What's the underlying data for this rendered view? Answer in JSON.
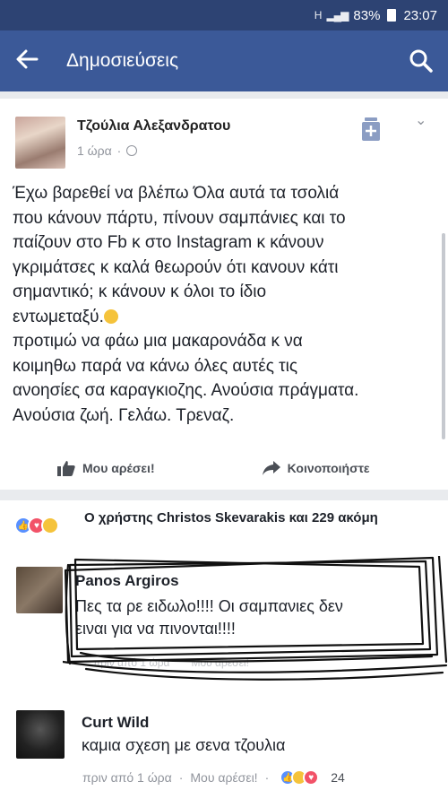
{
  "status_bar": {
    "network": "H",
    "battery": "83%",
    "time": "23:07"
  },
  "app_bar": {
    "title": "Δημοσιεύσεις",
    "back_icon": "arrow-left-icon",
    "search_icon": "search-icon"
  },
  "post": {
    "author": "Τζούλια Αλεξανδρατου",
    "time": "1 ώρα",
    "privacy_icon": "globe-icon",
    "body_part1": "Έχω βαρεθεί να βλέπω Όλα αυτά τα τσολιά\nπου κάνουν πάρτυ, πίνουν σαμπάνιες και το\nπαίζουν στο Fb κ στο Instagram κ κάνουν\nγκριμάτσες κ καλά θεωρούν ότι κανουν κάτι\nσημαντικό; κ κάνουν κ όλοι το ίδιο\nεντωμεταξύ.",
    "body_part2": "\nπροτιμώ να φάω μια μακαρονάδα κ να\nκοιμηθω παρά να κάνω όλες αυτές τις\nανοησίες σα καραγκιοζης. Ανούσια πράγματα.\nΑνούσια ζωή. Γελάω. Τρεναζ.",
    "like_label": "Μου αρέσει!",
    "share_label": "Κοινοποιήστε"
  },
  "reactions": {
    "summary": "Ο χρήστης Christos Skevarakis και 229 ακόμη",
    "types": [
      "like",
      "love",
      "haha"
    ]
  },
  "comments": [
    {
      "author": "Panos Argiros",
      "text": "Πες τα ρε ειδωλο!!!! Οι σαμπανιες δεν\nειναι για να πινονται!!!!",
      "meta_time": "πριν από 1 ώρα",
      "meta_like": "Μου αρέσει!"
    },
    {
      "author": "Curt Wild",
      "text": "καμια σχεση με σενα τζουλια",
      "meta_time": "πριν από 1 ώρα",
      "meta_like": "Μου αρέσει!",
      "separator": "·",
      "reaction_count": "24"
    }
  ],
  "colors": {
    "brand": "#3b5998",
    "status_bar": "#2d4373",
    "like_blue": "#5890ff",
    "love_red": "#f25268",
    "haha_yellow": "#f5c33b"
  }
}
